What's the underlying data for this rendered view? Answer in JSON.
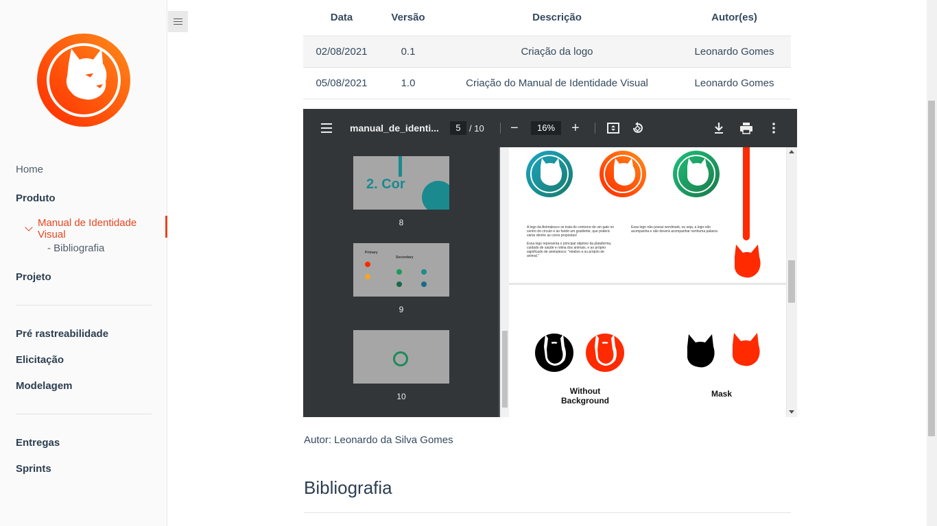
{
  "sidebar": {
    "items": {
      "home": "Home",
      "produto": "Produto",
      "manual": "Manual de Identidade Visual",
      "bibliografia": "- Bibliografia",
      "projeto": "Projeto",
      "pre_rastreabilidade": "Pré rastreabilidade",
      "elicitacao": "Elicitação",
      "modelagem": "Modelagem",
      "entregas": "Entregas",
      "sprints": "Sprints"
    }
  },
  "table": {
    "headers": [
      "Data",
      "Versão",
      "Descrição",
      "Autor(es)"
    ],
    "rows": [
      [
        "02/08/2021",
        "0.1",
        "Criação da logo",
        "Leonardo Gomes"
      ],
      [
        "05/08/2021",
        "1.0",
        "Criação do Manual de Identidade Visual",
        "Leonardo Gomes"
      ]
    ]
  },
  "pdf": {
    "title": "manual_de_identi...",
    "page": "5",
    "total": "/ 10",
    "zoom": "16%",
    "thumbs": [
      "8",
      "9",
      "10"
    ],
    "thumb8_text": "2. Cor",
    "thumb9_primary": "Primary",
    "thumb9_secondary": "Secondary",
    "page_text_left_1": "A logo da Animalesco se trata do contorno de um gato no centro do círculo e ao fundo um gradiente, que poderá variar dentre as cores propostas!",
    "page_text_left_2": "Essa logo representa o principal objetivo da plataforma, cuidado de saúde e rotina dos animais, e ao próprio significado de animalesco: \"relativo a ou próprio de animal.\"",
    "page_text_right": "Essa logo não possui wordmark, ou seja, a logo não acompanha e não deverá acompanhar nenhuma palavra",
    "caption_without": "Without Background",
    "caption_mask": "Mask",
    "colors": {
      "accent": "#e8441e",
      "teal": "#1a8a8f",
      "green": "#1e9a5a",
      "red": "#ff2a00"
    }
  },
  "author_line": "Autor: Leonardo da Silva Gomes",
  "biblio_heading": "Bibliografia"
}
